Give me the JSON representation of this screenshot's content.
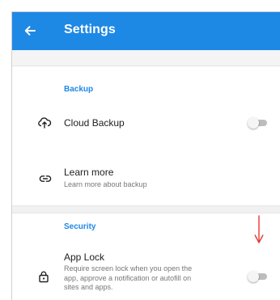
{
  "appbar": {
    "title": "Settings",
    "back_icon": "arrow-left-icon",
    "color": "#1e88e5"
  },
  "sections": {
    "backup": {
      "label": "Backup",
      "cloud_backup": {
        "label": "Cloud Backup",
        "icon": "cloud-sync-icon",
        "enabled": false
      },
      "learn_more": {
        "label": "Learn more",
        "subtitle": "Learn more about backup",
        "icon": "link-icon"
      }
    },
    "security": {
      "label": "Security",
      "app_lock": {
        "label": "App Lock",
        "subtitle_lines": [
          "Require screen lock when you open the",
          "app, approve a notification or autofill on",
          "sites and apps."
        ],
        "icon": "lock-icon",
        "enabled": false
      }
    }
  },
  "annotation": {
    "icon": "red-arrow-down-icon",
    "color": "#e53935"
  }
}
